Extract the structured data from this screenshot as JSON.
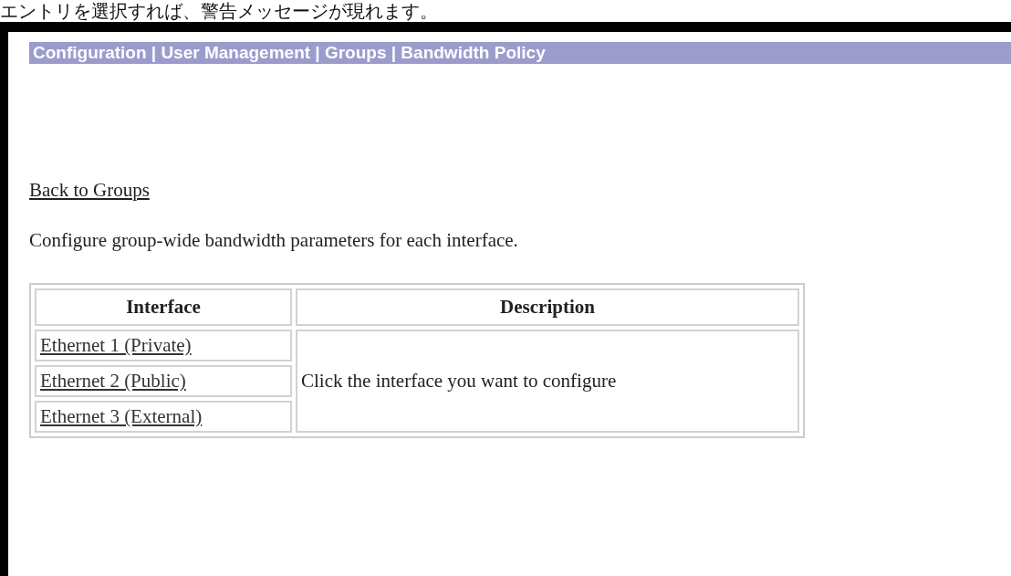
{
  "caption": "エントリを選択すれば、警告メッセージが現れます。",
  "breadcrumb": "Configuration | User Management | Groups | Bandwidth Policy",
  "back_link": "Back to Groups",
  "intro": "Configure group-wide bandwidth parameters for each interface.",
  "table": {
    "columns": [
      "Interface",
      "Description"
    ],
    "rows": [
      {
        "interface": "Ethernet 1 (Private)"
      },
      {
        "interface": "Ethernet 2 (Public)"
      },
      {
        "interface": "Ethernet 3 (External)"
      }
    ],
    "description": "Click the interface you want to configure"
  }
}
